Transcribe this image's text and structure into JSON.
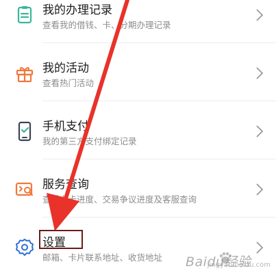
{
  "menu": {
    "items": [
      {
        "key": "records",
        "title": "我的办理记录",
        "subtitle": "查看我的借钱、卡、分期办理记录",
        "icon": "document-list-icon",
        "icon_color": "#39b69a"
      },
      {
        "key": "activities",
        "title": "我的活动",
        "subtitle": "查看热门活动",
        "icon": "gift-box-icon",
        "icon_color": "#f0773a"
      },
      {
        "key": "mobile-pay",
        "title": "手机支付",
        "subtitle": "我的第三方支付绑定记录",
        "icon": "phone-check-icon",
        "icon_color": "#3a4456"
      },
      {
        "key": "service-query",
        "title": "服务查询",
        "subtitle": "查看办卡进度、交易争议进度及客服查询",
        "icon": "service-search-icon",
        "icon_color": "#f0773a"
      },
      {
        "key": "settings",
        "title": "设置",
        "subtitle": "邮箱、卡片联系地址、收货地址",
        "icon": "gear-icon",
        "icon_color": "#2f6fd6"
      }
    ]
  },
  "annotation": {
    "arrow_color": "#e8322a",
    "box_color": "#6b1a1a"
  },
  "watermark": {
    "text": "Baidu经验",
    "sub": "jingyan.baidu.com"
  }
}
